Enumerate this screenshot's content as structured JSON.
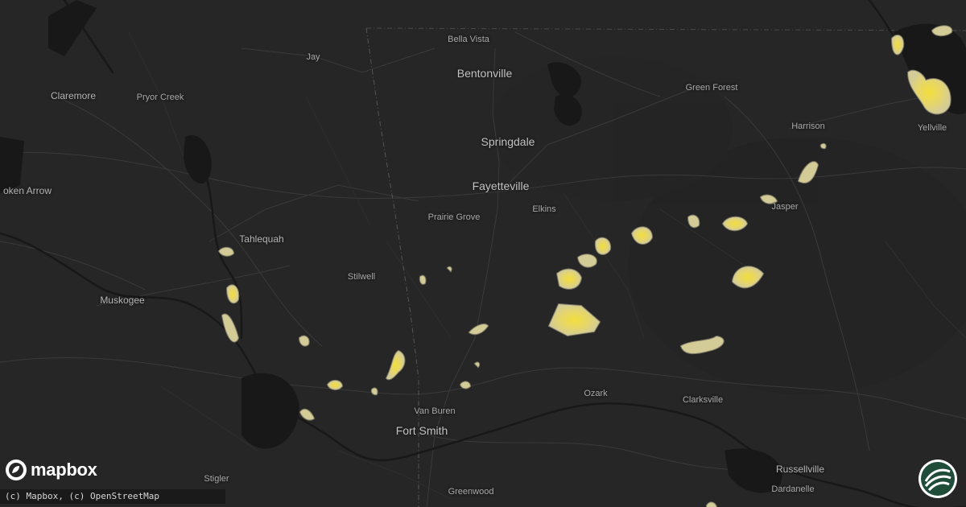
{
  "map": {
    "places": [
      {
        "id": "bella-vista",
        "name": "Bella Vista",
        "size": "sm"
      },
      {
        "id": "bentonville",
        "name": "Bentonville",
        "size": "lg"
      },
      {
        "id": "springdale",
        "name": "Springdale",
        "size": "lg"
      },
      {
        "id": "fayetteville",
        "name": "Fayetteville",
        "size": "lg"
      },
      {
        "id": "prairie-grove",
        "name": "Prairie Grove",
        "size": "sm"
      },
      {
        "id": "elkins",
        "name": "Elkins",
        "size": "sm"
      },
      {
        "id": "jay",
        "name": "Jay",
        "size": "sm"
      },
      {
        "id": "claremore",
        "name": "Claremore",
        "size": "md"
      },
      {
        "id": "pryor-creek",
        "name": "Pryor Creek",
        "size": "sm"
      },
      {
        "id": "broken-arrow",
        "name": "oken Arrow",
        "size": "md"
      },
      {
        "id": "tahlequah",
        "name": "Tahlequah",
        "size": "md"
      },
      {
        "id": "stilwell",
        "name": "Stilwell",
        "size": "sm"
      },
      {
        "id": "muskogee",
        "name": "Muskogee",
        "size": "md"
      },
      {
        "id": "green-forest",
        "name": "Green Forest",
        "size": "sm"
      },
      {
        "id": "harrison",
        "name": "Harrison",
        "size": "sm"
      },
      {
        "id": "jasper",
        "name": "Jasper",
        "size": "sm"
      },
      {
        "id": "yellville",
        "name": "Yellville",
        "size": "sm"
      },
      {
        "id": "ozark",
        "name": "Ozark",
        "size": "sm"
      },
      {
        "id": "clarksville",
        "name": "Clarksville",
        "size": "sm"
      },
      {
        "id": "van-buren",
        "name": "Van Buren",
        "size": "sm"
      },
      {
        "id": "fort-smith",
        "name": "Fort Smith",
        "size": "lg"
      },
      {
        "id": "greenwood",
        "name": "Greenwood",
        "size": "sm"
      },
      {
        "id": "stigler",
        "name": "Stigler",
        "size": "sm"
      },
      {
        "id": "russellville",
        "name": "Russellville",
        "size": "md"
      },
      {
        "id": "dardanelle",
        "name": "Dardanelle",
        "size": "sm"
      }
    ],
    "hail_colors": {
      "outer": "#d9d08f",
      "mid": "#e8d96a",
      "inner": "#f2de3c"
    },
    "background_color": "#262626"
  },
  "brand": {
    "logo_text": "mapbox",
    "logo_icon": "mapbox-logo-icon",
    "badge_icon": "site-badge-icon"
  },
  "attribution": "(c) Mapbox, (c) OpenStreetMap"
}
